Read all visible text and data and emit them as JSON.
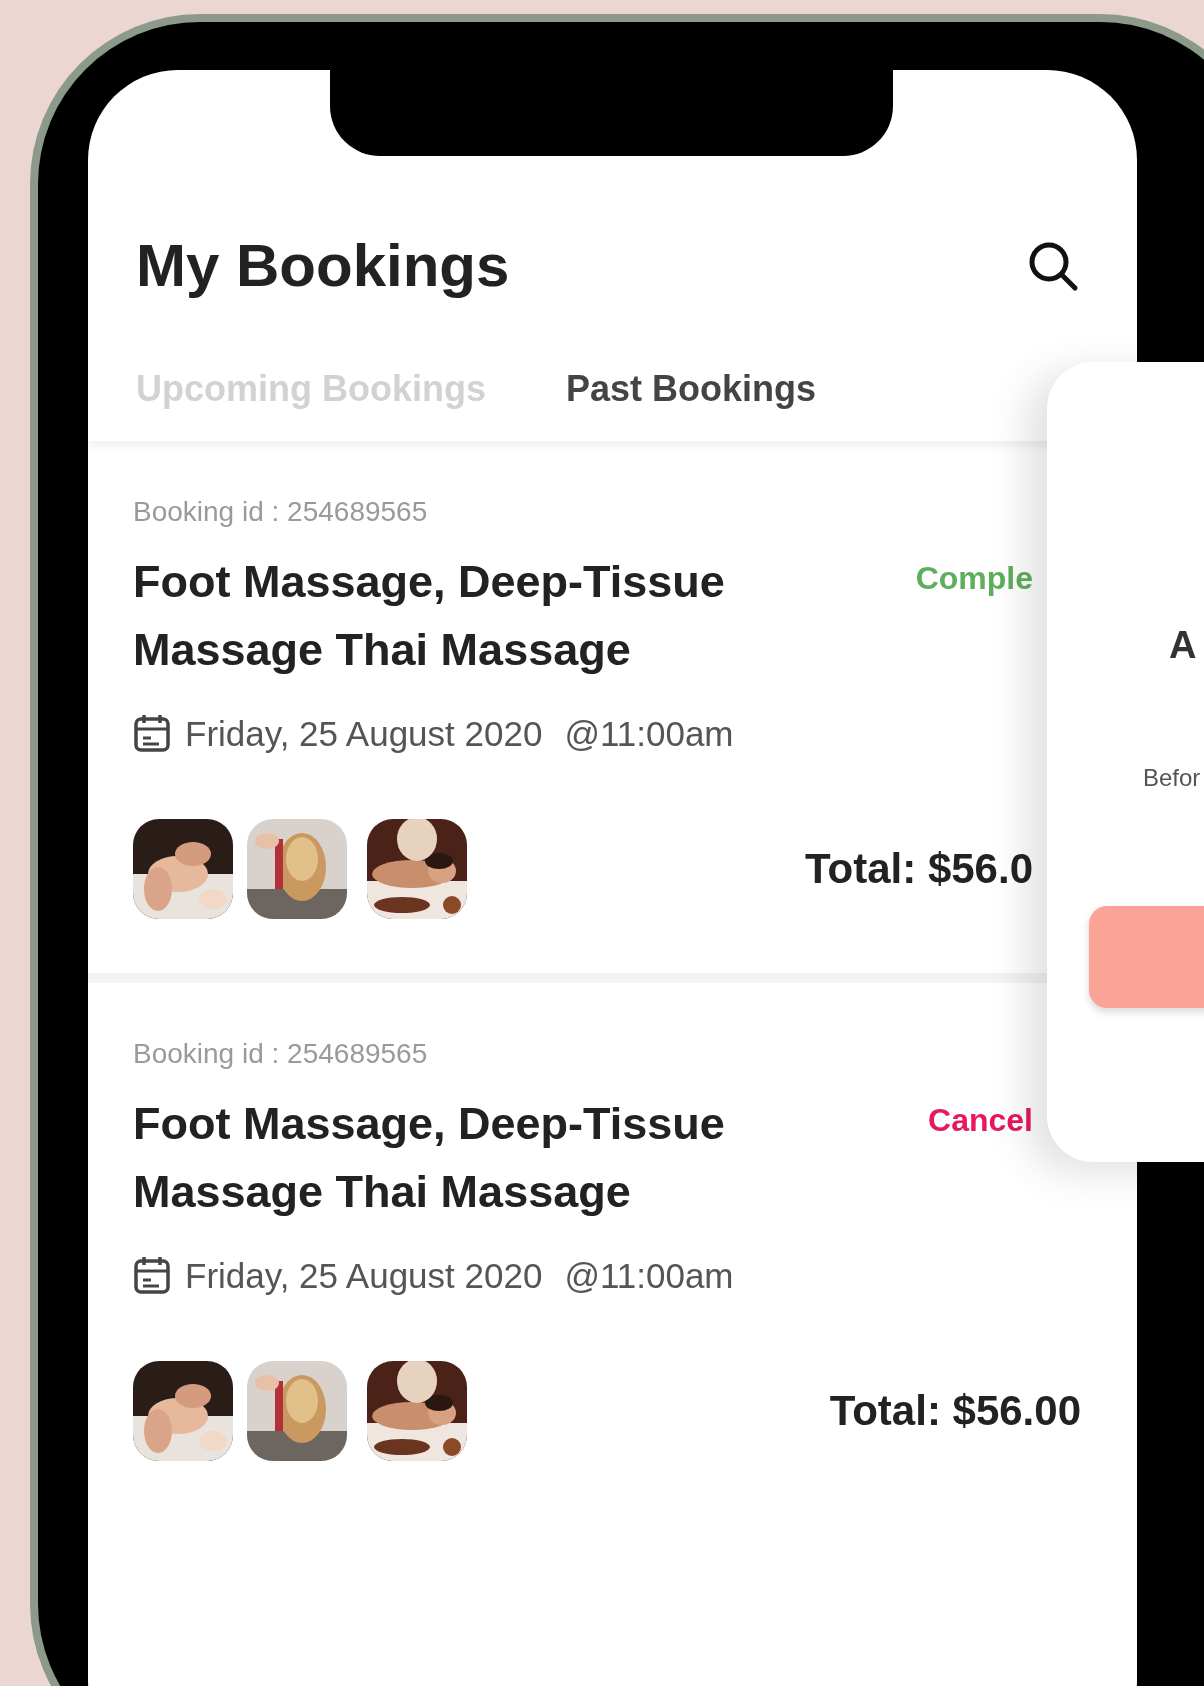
{
  "header": {
    "title": "My Bookings"
  },
  "tabs": [
    {
      "label": "Upcoming Bookings",
      "selected": false
    },
    {
      "label": "Past Bookings",
      "selected": true
    }
  ],
  "bookings": [
    {
      "booking_id": "Booking id : 254689565",
      "title": "Foot Massage, Deep-Tissue Massage Thai Massage",
      "status": {
        "label": "Comple",
        "kind": "completed"
      },
      "date": "Friday, 25 August 2020",
      "time": "@11:00am",
      "total": "Total: $56.0"
    },
    {
      "booking_id": "Booking id : 254689565",
      "title": "Foot Massage, Deep-Tissue Massage Thai Massage",
      "status": {
        "label": "Cancel",
        "kind": "cancelled"
      },
      "date": "Friday, 25 August 2020",
      "time": "@11:00am",
      "total": "Total: $56.00"
    }
  ],
  "dialog": {
    "heading": "A",
    "text": "Befor"
  }
}
